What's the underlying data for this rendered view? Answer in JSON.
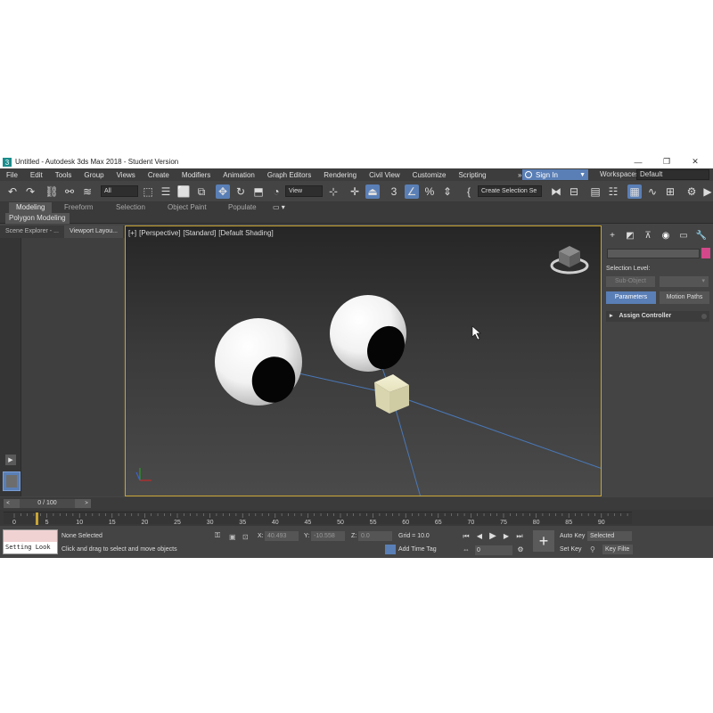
{
  "window": {
    "title": "Untitled - Autodesk 3ds Max 2018 - Student Version",
    "minimize": "—",
    "restore": "❐",
    "close": "✕"
  },
  "menu": {
    "items": [
      "File",
      "Edit",
      "Tools",
      "Group",
      "Views",
      "Create",
      "Modifiers",
      "Animation",
      "Graph Editors",
      "Rendering",
      "Civil View",
      "Customize",
      "Scripting"
    ],
    "more": "»",
    "sign_in": "Sign In",
    "workspaces_label": "Workspaces:",
    "workspace_value": "Default"
  },
  "toolbar": {
    "selection_filter": "All",
    "ref_coord": "View",
    "named_selection": "Create Selection Se"
  },
  "ribbon": {
    "tabs": [
      "Modeling",
      "Freeform",
      "Selection",
      "Object Paint",
      "Populate"
    ],
    "sub_label": "Polygon Modeling"
  },
  "left_panel": {
    "tabs": [
      "Scene Explorer - ...",
      "Viewport Layou..."
    ]
  },
  "viewport": {
    "labels": [
      "[+]",
      "[Perspective]",
      "[Standard]",
      "[Default Shading]"
    ]
  },
  "command_panel": {
    "selection_level": "Selection Level:",
    "sub_object": "Sub-Object",
    "parameters": "Parameters",
    "motion_paths": "Motion Paths",
    "assign_controller": "Assign Controller",
    "rollout_arrow": "▸"
  },
  "time_slider": {
    "label": "0 / 100",
    "prev": "<",
    "next": ">"
  },
  "trackbar": {
    "ticks": [
      "0",
      "5",
      "10",
      "15",
      "20",
      "25",
      "30",
      "35",
      "40",
      "45",
      "50",
      "55",
      "60",
      "65",
      "70",
      "75",
      "80",
      "85",
      "90"
    ]
  },
  "status": {
    "script_text": "Setting Look",
    "selection": "None Selected",
    "prompt": "Click and drag to select and move objects",
    "x_label": "X:",
    "x_value": "40.493",
    "y_label": "Y:",
    "y_value": "-10.558",
    "z_label": "Z:",
    "z_value": "0.0",
    "grid": "Grid = 10.0",
    "add_time_tag": "Add Time Tag",
    "auto_key": "Auto Key",
    "selected": "Selected",
    "set_key": "Set Key",
    "key_filters": "Key Filte",
    "frame_value": "0"
  },
  "colors": {
    "accent": "#5a7fb6",
    "viewport_border": "#c8a534",
    "object_color": "#d3488a"
  }
}
